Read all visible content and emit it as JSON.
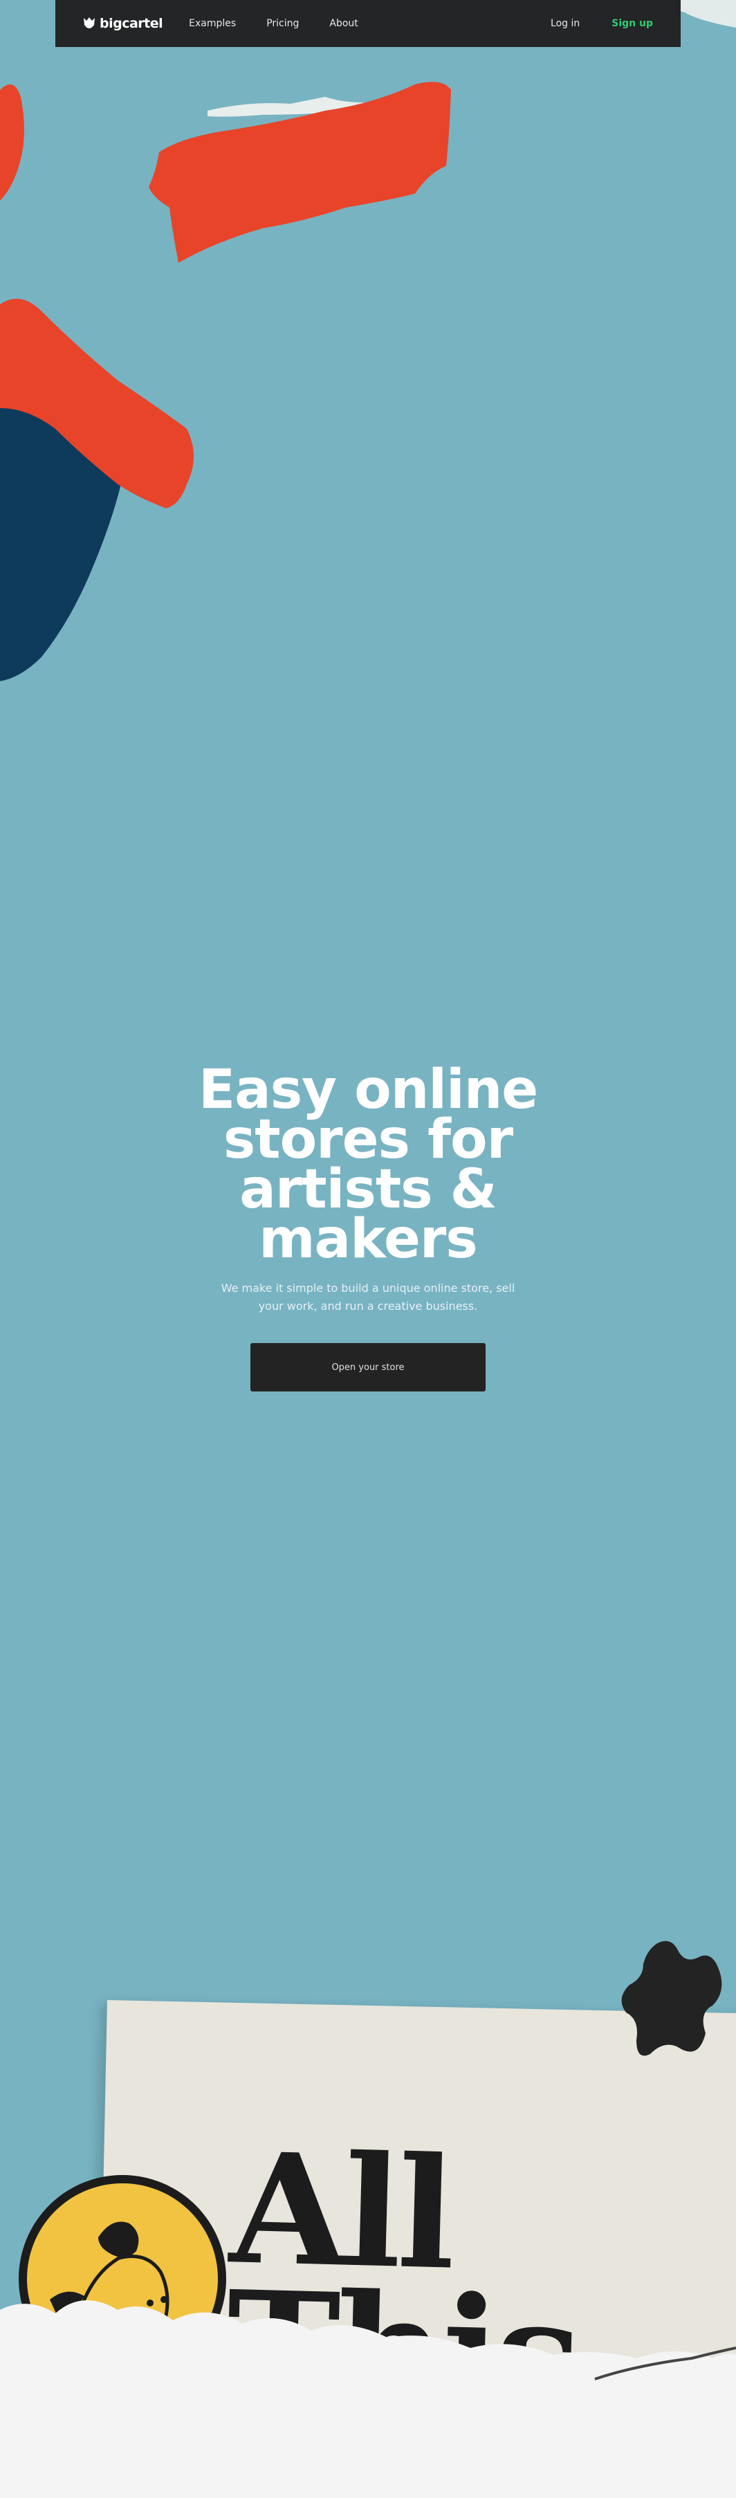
{
  "nav": {
    "logo_text": "bigcartel",
    "links": [
      {
        "label": "Examples"
      },
      {
        "label": "Pricing"
      },
      {
        "label": "About"
      }
    ],
    "login_label": "Log in",
    "signup_label": "Sign up"
  },
  "hero": {
    "title": "Easy online stores for artists & makers",
    "subtitle": "We make it simple to build a unique online store, sell your work, and run a creative business.",
    "cta_label": "Open your store"
  },
  "collage": {
    "poster_text": "All This"
  },
  "colors": {
    "background": "#78b3c2",
    "navbar": "#232526",
    "signup": "#2ecc71",
    "paint_red": "#e8442a",
    "paint_navy": "#0e3b5c",
    "cta_bg": "#232323"
  },
  "icons": [
    "bigcartel-logo-icon"
  ]
}
